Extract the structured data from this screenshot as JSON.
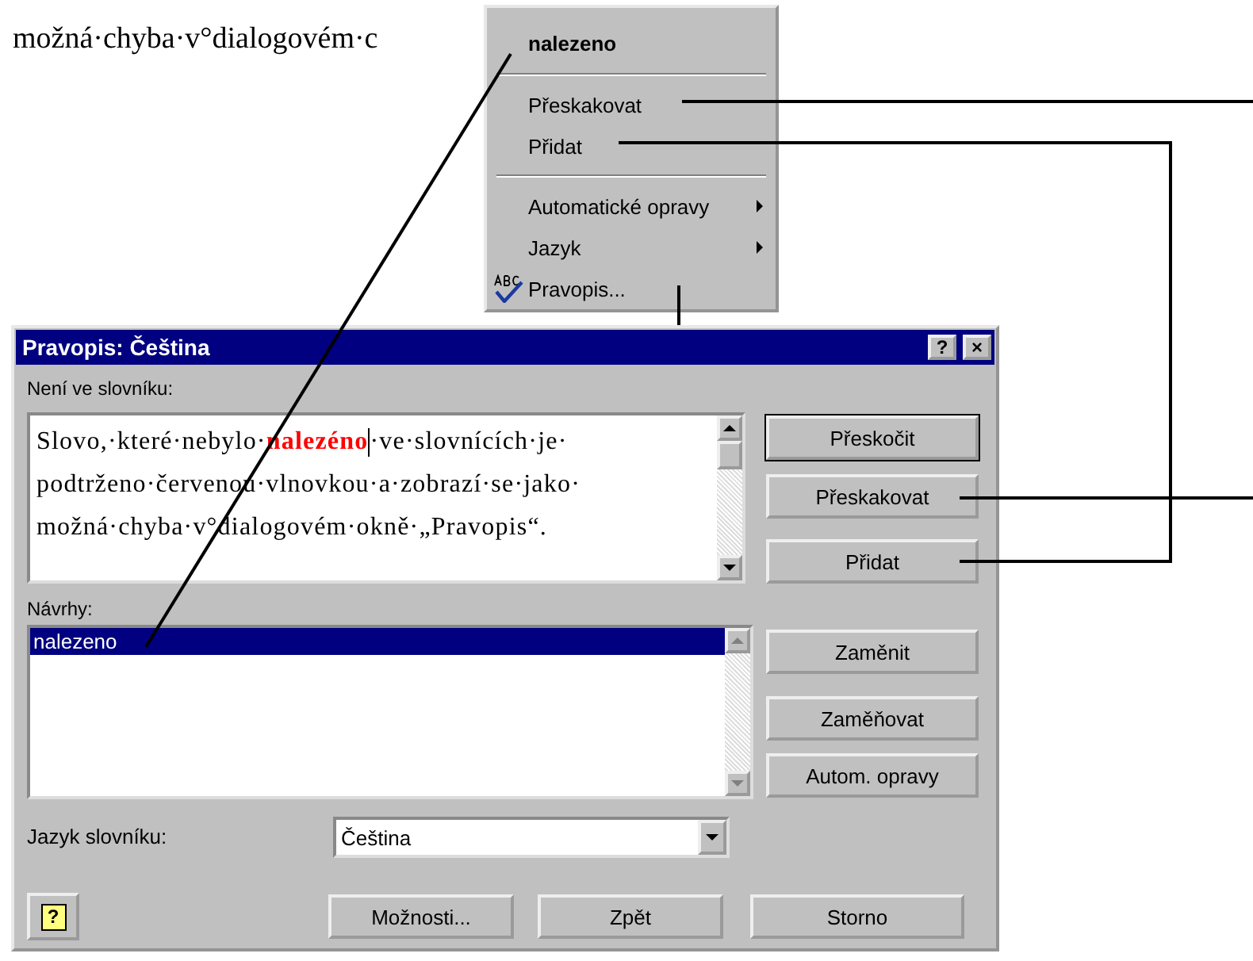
{
  "document": {
    "text_line": "možná·chyba·v°dialogovém·c"
  },
  "context_menu": {
    "items": [
      {
        "kind": "suggestion",
        "label": "nalezeno"
      },
      {
        "kind": "separator"
      },
      {
        "kind": "command",
        "label": "Přeskakovat"
      },
      {
        "kind": "command",
        "label": "Přidat"
      },
      {
        "kind": "separator"
      },
      {
        "kind": "submenu",
        "label": "Automatické opravy"
      },
      {
        "kind": "submenu",
        "label": "Jazyk"
      },
      {
        "kind": "spelling",
        "label": "Pravopis..."
      }
    ]
  },
  "dialog": {
    "title": "Pravopis: Čeština",
    "title_buttons": [
      "?",
      "×"
    ],
    "not_in_dictionary": {
      "label": "Není ve slovníku:",
      "text_before": "Slovo,·které·nebylo·",
      "error_word": "nalezéno",
      "text_after": "·ve·slovnících·je· podtrženo·červenou·vlnovkou·a·zobrazí·se·jako· možná·chyba·v°dialogovém·okně·„Pravopis“."
    },
    "suggestions": {
      "label": "Návrhy:",
      "items": [
        {
          "label": "nalezeno",
          "selected": true
        }
      ]
    },
    "language": {
      "label": "Jazyk slovníku:",
      "value": "Čeština"
    },
    "side_buttons": [
      {
        "label": "Přeskočit",
        "default": true
      },
      {
        "label": "Přeskakovat",
        "default": false
      },
      {
        "label": "Přidat",
        "default": false
      },
      {
        "label": "Zaměnit",
        "default": false
      },
      {
        "label": "Zaměňovat",
        "default": false
      },
      {
        "label": "Autom. opravy",
        "default": false
      }
    ],
    "help_button": {
      "glyph": "?"
    },
    "bottom_buttons": [
      "Možnosti...",
      "Zpět",
      "Storno"
    ]
  }
}
